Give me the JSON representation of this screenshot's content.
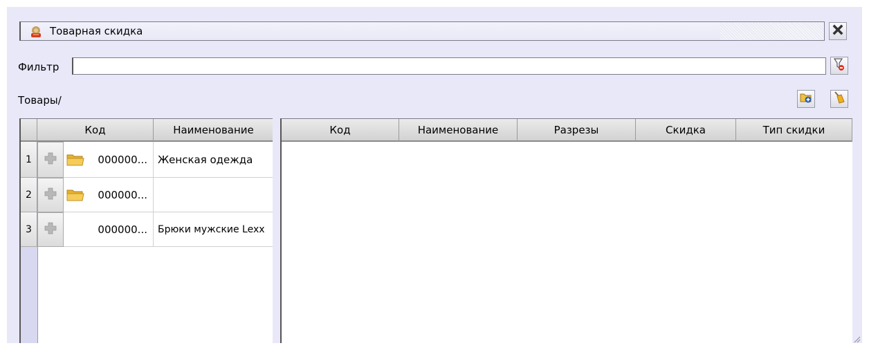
{
  "window": {
    "title": "Товарная скидка",
    "filter_label": "Фильтр",
    "filter_value": "",
    "path": "Товары/"
  },
  "left_grid": {
    "columns": [
      "Код",
      "Наименование"
    ],
    "rows": [
      {
        "num": "1",
        "code": "000000...",
        "name": "Женская одежда",
        "is_group": true
      },
      {
        "num": "2",
        "code": "000000...",
        "name": "",
        "is_group": true
      },
      {
        "num": "3",
        "code": "000000...",
        "name": "Брюки мужские Lexx",
        "is_group": false
      }
    ]
  },
  "right_grid": {
    "columns": [
      "Код",
      "Наименование",
      "Разрезы",
      "Скидка",
      "Тип скидки"
    ],
    "rows": []
  },
  "icons": {
    "title": "discount-icon",
    "close": "close-icon",
    "filter": "filter-clear-icon",
    "add": "add-folder-icon",
    "clear": "broom-icon",
    "expand": "plus-icon",
    "folder": "folder-icon"
  },
  "colors": {
    "panel_bg": "#e8e8f8",
    "header_bg": "#d8d8d8",
    "rownum_bg": "#d8d8f0"
  }
}
